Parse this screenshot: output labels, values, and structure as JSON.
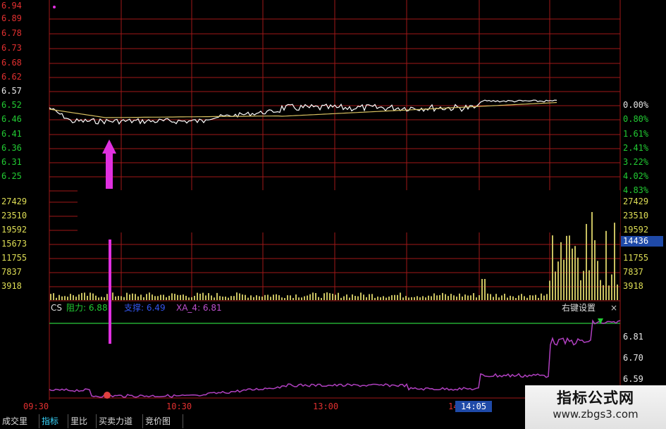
{
  "price_axis": {
    "labels": [
      {
        "text": "6.94",
        "color": "red"
      },
      {
        "text": "6.89",
        "color": "red"
      },
      {
        "text": "6.78",
        "color": "red"
      },
      {
        "text": "6.73",
        "color": "red"
      },
      {
        "text": "6.68",
        "color": "red"
      },
      {
        "text": "6.62",
        "color": "red"
      },
      {
        "text": "6.57",
        "color": "white"
      },
      {
        "text": "6.52",
        "color": "green"
      },
      {
        "text": "6.46",
        "color": "green"
      },
      {
        "text": "6.41",
        "color": "green"
      },
      {
        "text": "6.36",
        "color": "green"
      },
      {
        "text": "6.31",
        "color": "green"
      },
      {
        "text": "6.25",
        "color": "green"
      }
    ]
  },
  "pct_axis": {
    "labels": [
      "0.00%",
      "0.80%",
      "1.61%",
      "2.41%",
      "3.22%",
      "4.02%",
      "4.83%"
    ]
  },
  "volume_axis": {
    "labels": [
      "27429",
      "23510",
      "19592",
      "15673",
      "11755",
      "7837",
      "3918"
    ]
  },
  "current_volume": "14436",
  "indicator_header": {
    "name": "CS",
    "resistance_label": "阻力: 6.88",
    "support_label": "支撑: 6.49",
    "xa4_label": "XA_4: 6.81",
    "settings_label": "右键设置",
    "close_label": "×"
  },
  "indicator_axis": {
    "labels": [
      "6.81",
      "6.70",
      "6.59"
    ]
  },
  "time_axis": {
    "labels": [
      "09:30",
      "10:30",
      "13:00",
      "14"
    ],
    "crosshair_time": "14:05"
  },
  "tabs": [
    {
      "label": "成交里",
      "active": false
    },
    {
      "label": "指标",
      "active": true
    },
    {
      "label": "里比",
      "active": false
    },
    {
      "label": "买卖力道",
      "active": false
    },
    {
      "label": "竞价图",
      "active": false
    }
  ],
  "watermark": {
    "title": "指标公式网",
    "url": "www.zbgs3.com"
  },
  "colors": {
    "grid": "#a01818",
    "price_line": "#ffffff",
    "avg_line": "#d8c060",
    "volume": "#c8c060",
    "indicator_line": "#b040c0",
    "resistance_line": "#22aa33",
    "arrow": "#e030e0",
    "tab_active": "#39d8ff"
  }
}
